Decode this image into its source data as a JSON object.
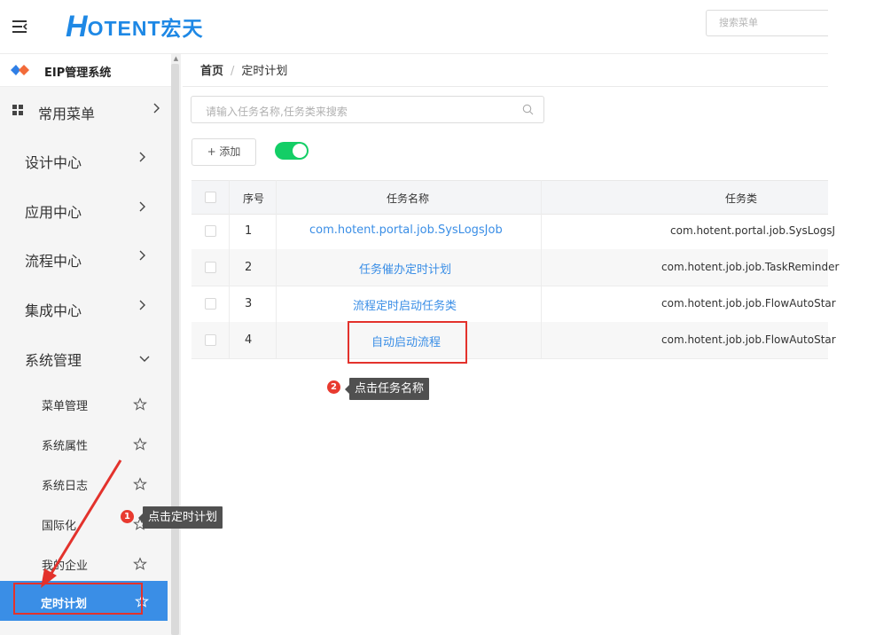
{
  "header": {
    "logo_h": "H",
    "logo_rest": "OTENT宏天",
    "search_placeholder": "搜索菜单"
  },
  "sidebar": {
    "system_name": "EIP管理系统",
    "items": [
      {
        "label": "常用菜单"
      },
      {
        "label": "设计中心"
      },
      {
        "label": "应用中心"
      },
      {
        "label": "流程中心"
      },
      {
        "label": "集成中心"
      },
      {
        "label": "系统管理"
      }
    ],
    "sub_items": [
      {
        "label": "菜单管理"
      },
      {
        "label": "系统属性"
      },
      {
        "label": "系统日志"
      },
      {
        "label": "国际化"
      },
      {
        "label": "我的企业"
      },
      {
        "label": "定时计划"
      }
    ]
  },
  "breadcrumb": {
    "home": "首页",
    "separator": "/",
    "current": "定时计划"
  },
  "toolbar": {
    "search_placeholder": "请输入任务名称,任务类来搜索",
    "add_label": "+ 添加"
  },
  "table": {
    "headers": {
      "index": "序号",
      "name": "任务名称",
      "class": "任务类"
    },
    "rows": [
      {
        "index": "1",
        "name": "com.hotent.portal.job.SysLogsJob",
        "class": "com.hotent.portal.job.SysLogsJ"
      },
      {
        "index": "2",
        "name": "任务催办定时计划",
        "class": "com.hotent.job.job.TaskReminder"
      },
      {
        "index": "3",
        "name": "流程定时启动任务类",
        "class": "com.hotent.job.job.FlowAutoStar"
      },
      {
        "index": "4",
        "name": "自动启动流程",
        "class": "com.hotent.job.job.FlowAutoStar"
      }
    ]
  },
  "callouts": [
    {
      "num": "1",
      "text": "点击定时计划"
    },
    {
      "num": "2",
      "text": "点击任务名称"
    }
  ],
  "colors": {
    "brand": "#1e88e5",
    "accent": "#3a8ee6",
    "toggle_on": "#13ce66",
    "annotation_red": "#e3322c"
  }
}
